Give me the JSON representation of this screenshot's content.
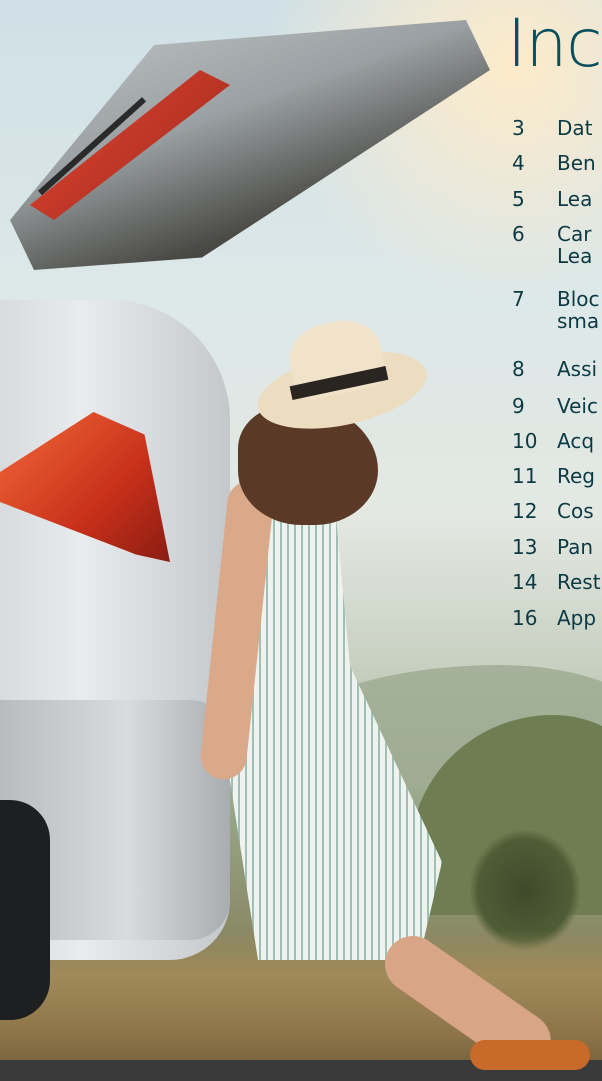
{
  "toc": {
    "title": "Inc",
    "items": [
      {
        "page": "3",
        "label": "Dat"
      },
      {
        "page": "4",
        "label": "Ben"
      },
      {
        "page": "5",
        "label": "Lea"
      },
      {
        "page": "6",
        "label": "Car\nLea"
      },
      {
        "page": "7",
        "label": "Bloc\nsma"
      },
      {
        "page": "8",
        "label": "Assi"
      },
      {
        "page": "9",
        "label": "Veic"
      },
      {
        "page": "10",
        "label": "Acq"
      },
      {
        "page": "11",
        "label": "Reg"
      },
      {
        "page": "12",
        "label": "Cos"
      },
      {
        "page": "13",
        "label": "Pan"
      },
      {
        "page": "14",
        "label": "Rest"
      },
      {
        "page": "16",
        "label": "App"
      }
    ]
  },
  "colors": {
    "title": "#0b4f5e",
    "text": "#0c3a44"
  }
}
